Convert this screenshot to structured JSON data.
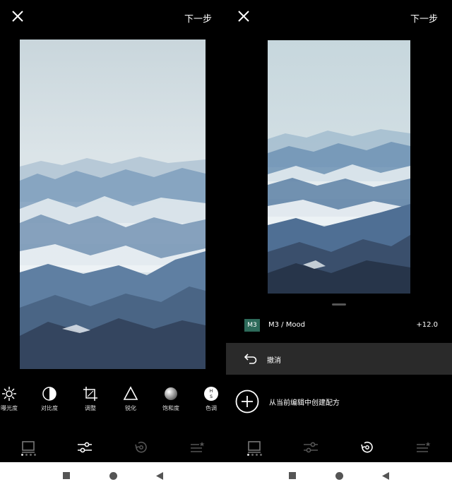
{
  "left": {
    "close_icon": "close-icon",
    "next_label": "下一步",
    "tools": [
      {
        "icon": "exposure-icon",
        "label": "曝光度"
      },
      {
        "icon": "contrast-icon",
        "label": "对比度"
      },
      {
        "icon": "crop-icon",
        "label": "调整"
      },
      {
        "icon": "sharpen-icon",
        "label": "锐化"
      },
      {
        "icon": "saturation-icon",
        "label": "饱和度"
      },
      {
        "icon": "hsl-icon",
        "label": "色调"
      }
    ],
    "nav": [
      "gallery-icon",
      "sliders-icon",
      "history-icon",
      "recipes-icon"
    ],
    "active_nav": 1
  },
  "right": {
    "close_icon": "close-icon",
    "next_label": "下一步",
    "recipe": {
      "badge": "M3",
      "name": "M3 / Mood",
      "value": "+12.0"
    },
    "undo_label": "撤消",
    "create_label": "从当前编辑中创建配方",
    "nav": [
      "gallery-icon",
      "sliders-icon",
      "history-icon",
      "recipes-icon"
    ],
    "active_nav": 2
  },
  "colors": {
    "badge": "#2d6a5a",
    "sky": "#d5dfe3",
    "mountain_dark": "#2f3e55",
    "mountain_light": "#6f93b5"
  }
}
